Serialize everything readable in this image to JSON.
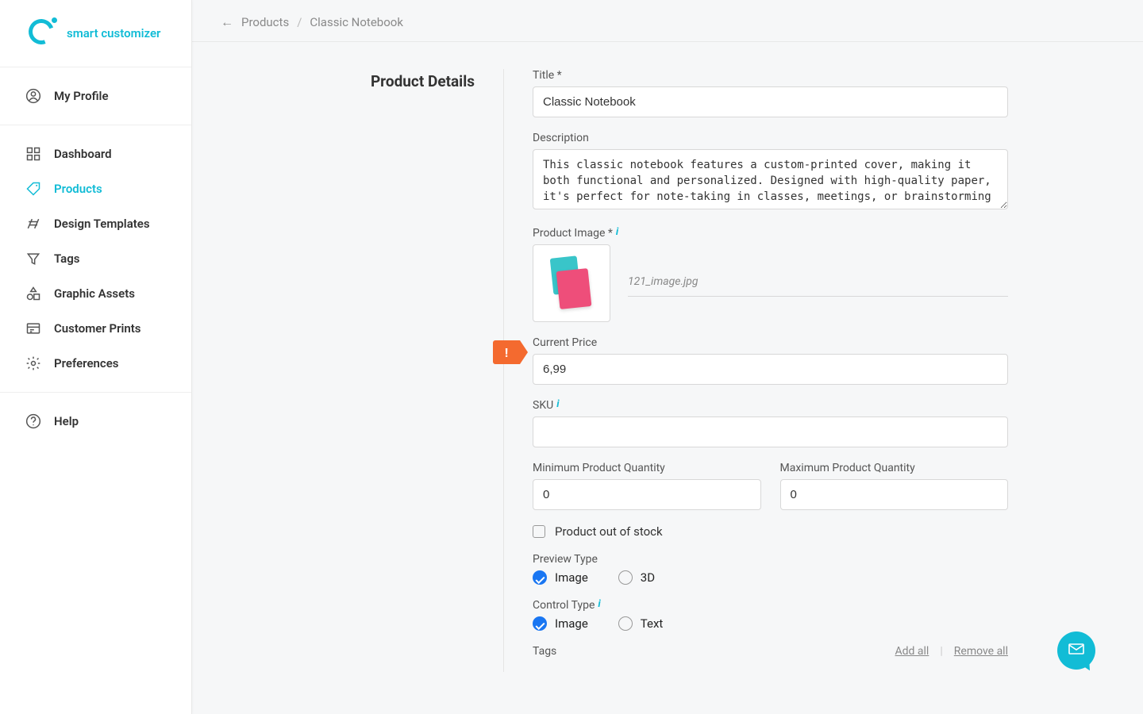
{
  "brand": {
    "name": "smart customizer"
  },
  "sidebar": {
    "profile": "My Profile",
    "items": [
      {
        "label": "Dashboard"
      },
      {
        "label": "Products"
      },
      {
        "label": "Design Templates"
      },
      {
        "label": "Tags"
      },
      {
        "label": "Graphic Assets"
      },
      {
        "label": "Customer Prints"
      },
      {
        "label": "Preferences"
      }
    ],
    "help": "Help"
  },
  "breadcrumb": {
    "parent": "Products",
    "current": "Classic Notebook"
  },
  "section_title": "Product Details",
  "form": {
    "title_label": "Title *",
    "title_value": "Classic Notebook",
    "description_label": "Description",
    "description_value": "This classic notebook features a custom-printed cover, making it both functional and personalized. Designed with high-quality paper, it's perfect for note-taking in classes, meetings, or brainstorming",
    "product_image_label": "Product Image *",
    "image_filename": "121_image.jpg",
    "current_price_label": "Current Price",
    "current_price_value": "6,99",
    "price_error": "!",
    "sku_label": "SKU",
    "sku_value": "",
    "min_qty_label": "Minimum Product Quantity",
    "min_qty_value": "0",
    "max_qty_label": "Maximum Product Quantity",
    "max_qty_value": "0",
    "out_of_stock_label": "Product out of stock",
    "preview_type_label": "Preview Type",
    "preview_type_options": {
      "image": "Image",
      "threed": "3D"
    },
    "control_type_label": "Control Type",
    "control_type_options": {
      "image": "Image",
      "text": "Text"
    },
    "tags_label": "Tags",
    "tags_add_all": "Add all",
    "tags_remove_all": "Remove all"
  }
}
